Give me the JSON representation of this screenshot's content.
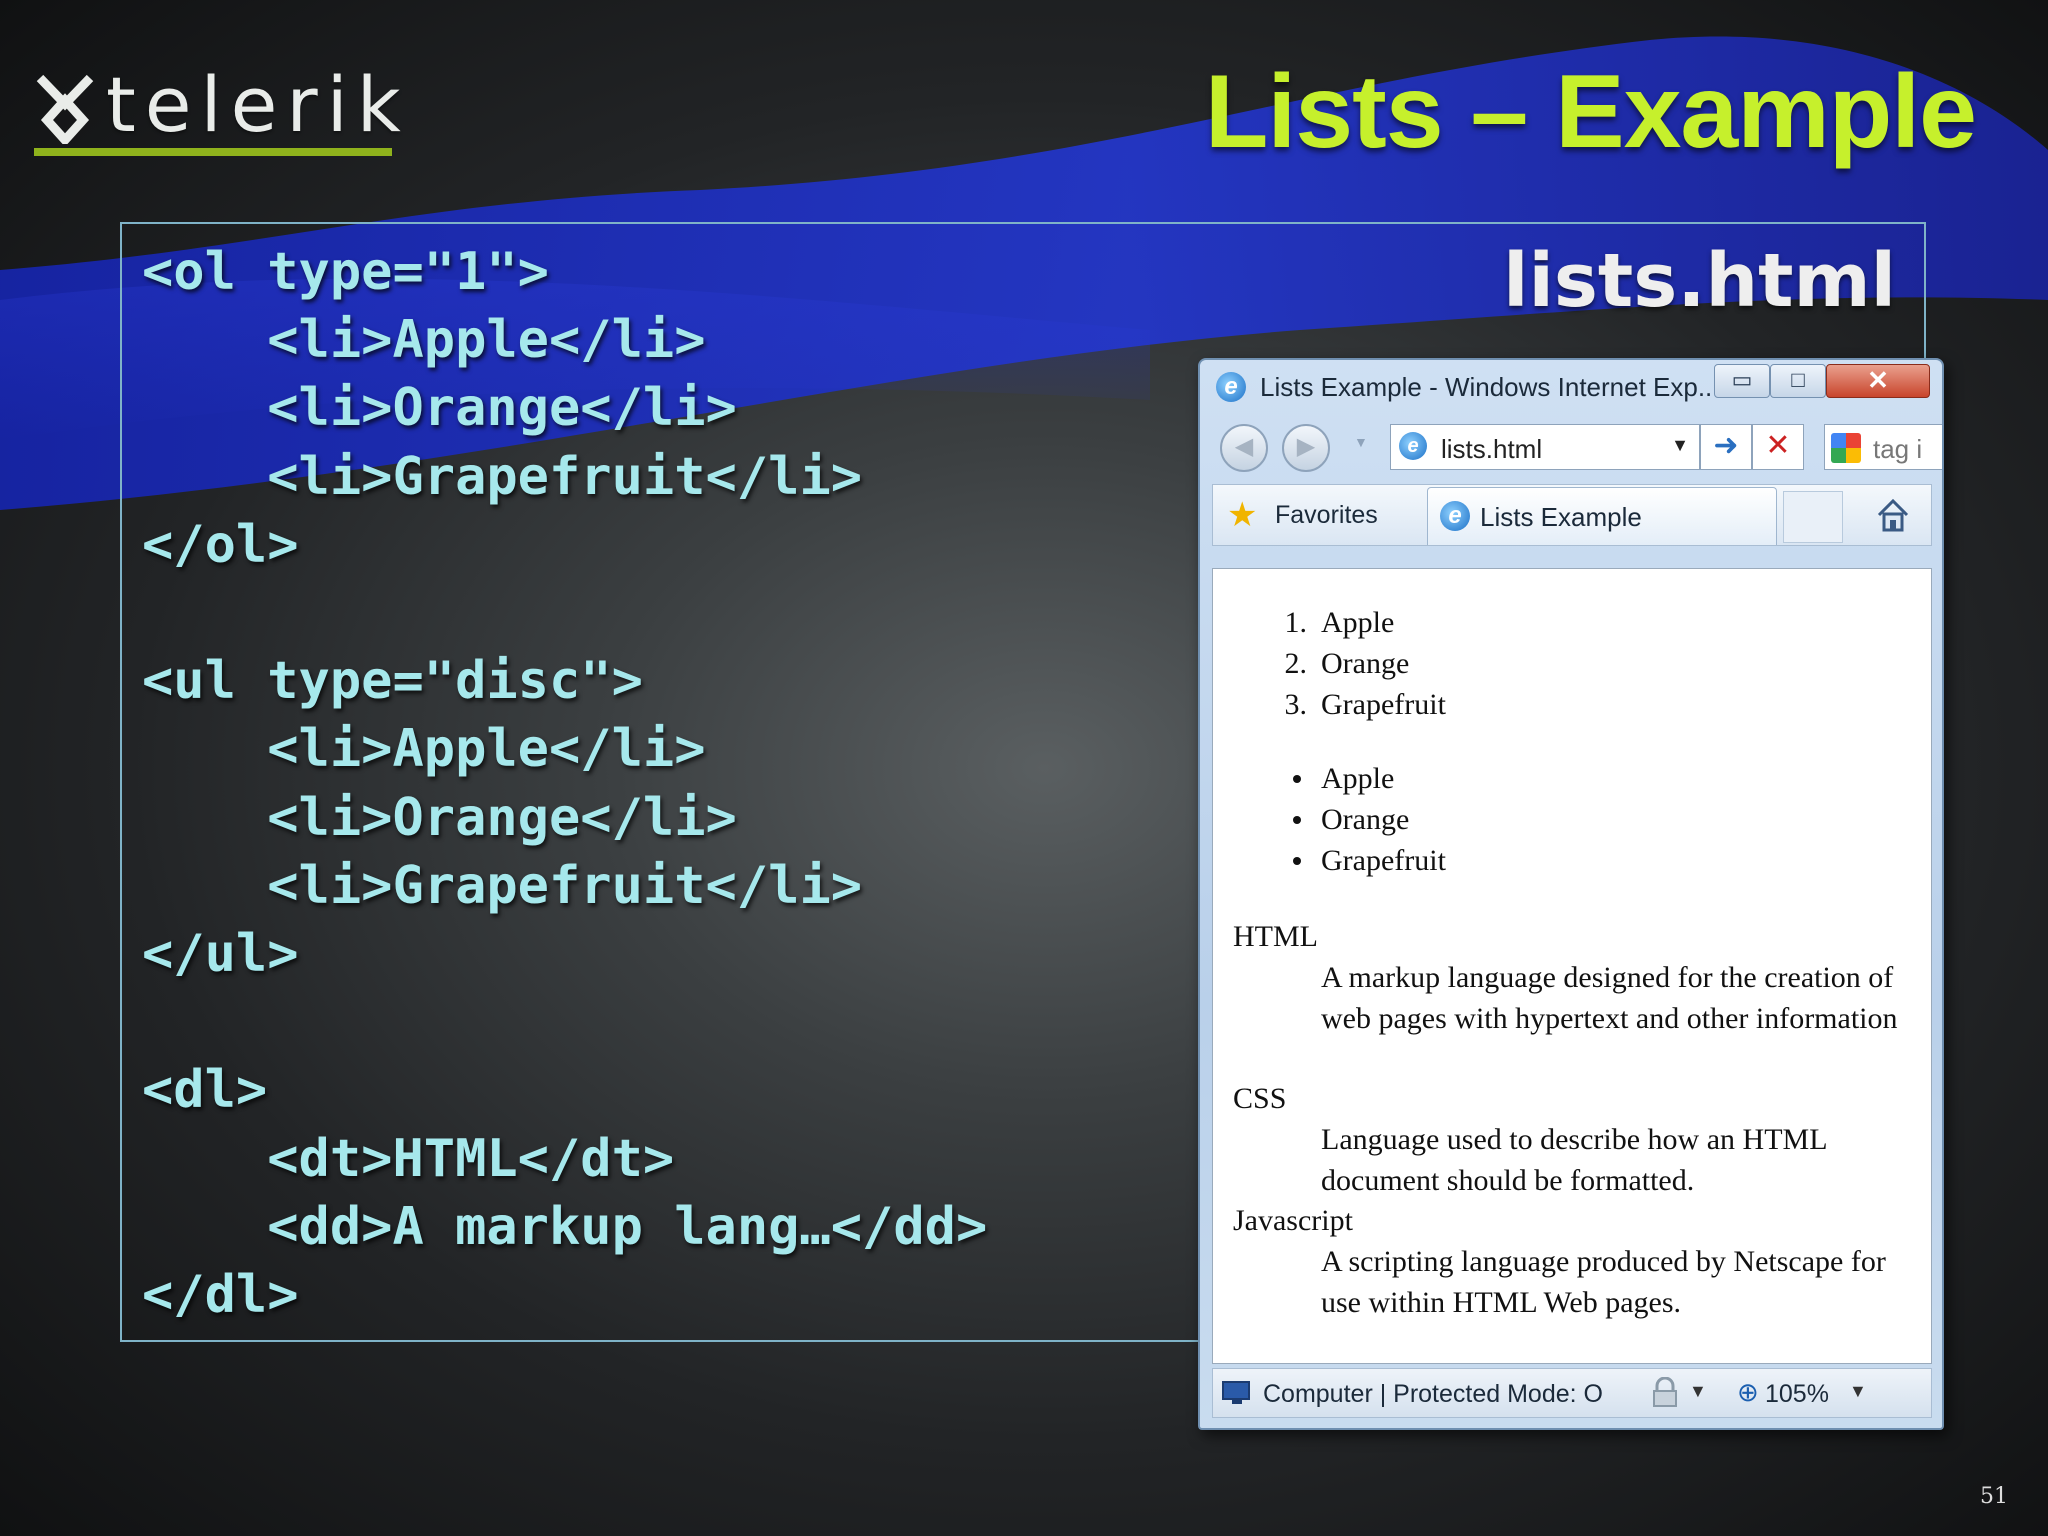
{
  "slide": {
    "logo_text": "telerik",
    "title": "Lists – Example",
    "filename": "lists.html",
    "page_number": "51",
    "code": "<ol type=\"1\">\n    <li>Apple</li>\n    <li>Orange</li>\n    <li>Grapefruit</li>\n</ol>\n\n<ul type=\"disc\">\n    <li>Apple</li>\n    <li>Orange</li>\n    <li>Grapefruit</li>\n</ul>\n\n<dl>\n    <dt>HTML</dt>\n    <dd>A markup lang…</dd>\n</dl>",
    "colors": {
      "title": "#c6f02c",
      "code": "#a6e8ec",
      "logo_underline": "#8fb21c",
      "wave": "#1f2fb8"
    }
  },
  "browser": {
    "window_title": "Lists Example - Windows Internet Exp...",
    "address": "lists.html",
    "search_placeholder": "tag i",
    "favorites_label": "Favorites",
    "tab_label": "Lists Example",
    "ordered_list": [
      {
        "marker": "1.",
        "text": "Apple"
      },
      {
        "marker": "2.",
        "text": "Orange"
      },
      {
        "marker": "3.",
        "text": "Grapefruit"
      }
    ],
    "unordered_list": [
      "Apple",
      "Orange",
      "Grapefruit"
    ],
    "definitions": [
      {
        "term": "HTML",
        "definition": "A markup language designed for the creation of web pages with hypertext and other information"
      },
      {
        "term": "CSS",
        "definition": "Language used to describe how an HTML document should be formatted."
      },
      {
        "term": "Javascript",
        "definition": "A scripting language produced by Netscape for use within HTML Web pages."
      }
    ],
    "status_text": "Computer | Protected Mode: O",
    "zoom": "105%",
    "icons": [
      "ie-icon",
      "minimize-icon",
      "maximize-icon",
      "close-icon",
      "back-icon",
      "forward-icon",
      "go-icon",
      "stop-icon",
      "google-icon",
      "star-icon",
      "home-icon",
      "monitor-icon",
      "lock-icon",
      "zoom-icon"
    ]
  }
}
